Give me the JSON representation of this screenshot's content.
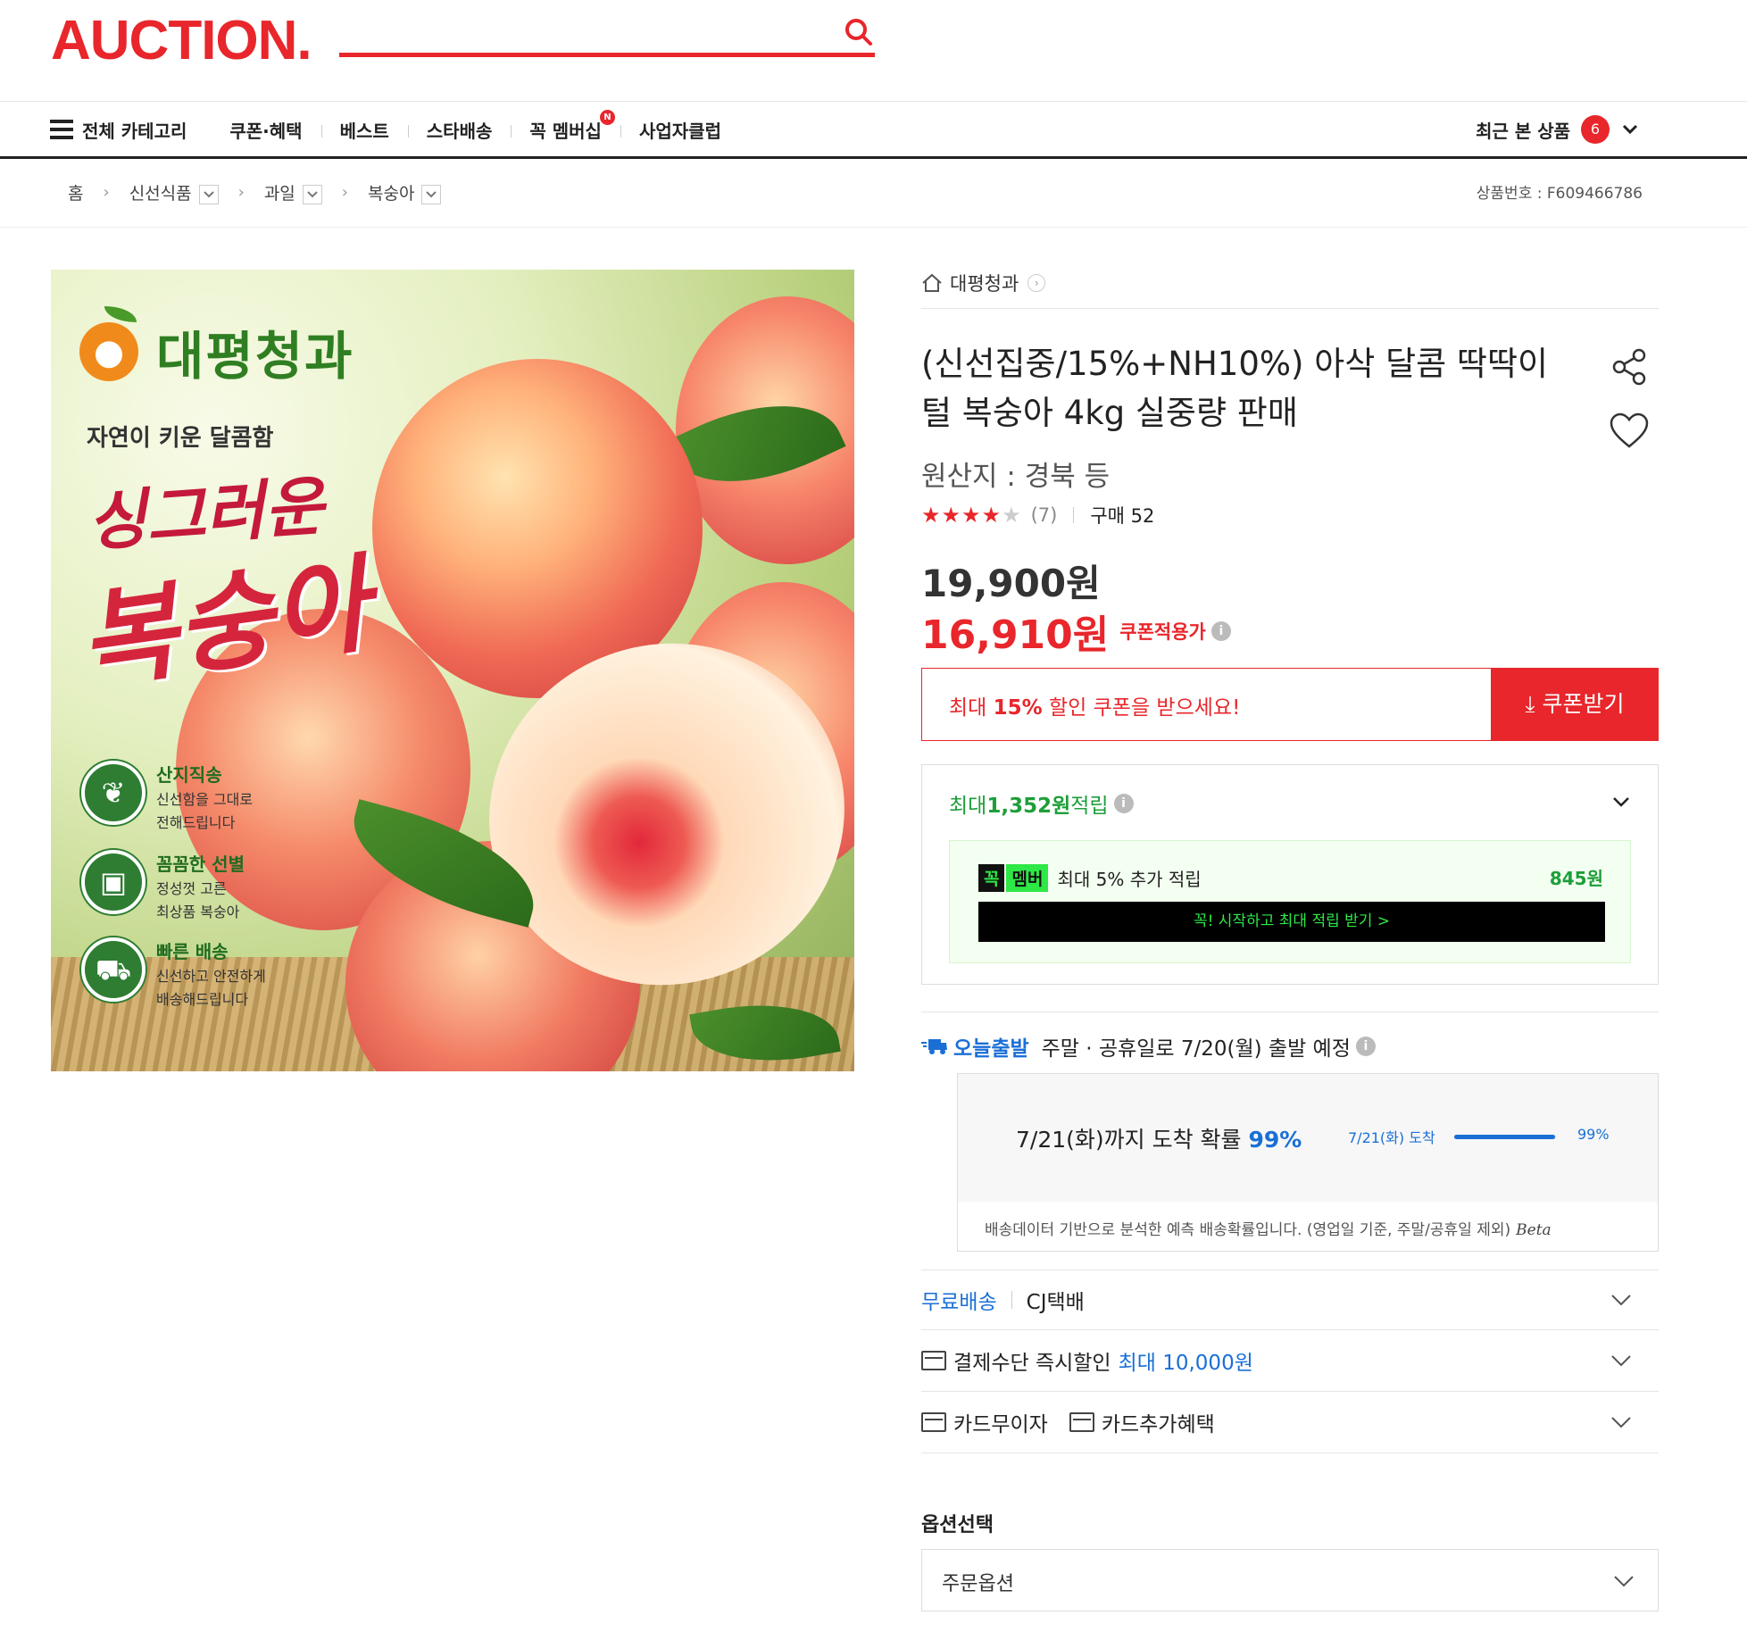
{
  "header": {
    "logo": "AUCTION.",
    "search_placeholder": ""
  },
  "gnb": {
    "all_categories": "전체 카테고리",
    "items": [
      "쿠폰·혜택",
      "베스트",
      "스타배송",
      "꼭 멤버십",
      "사업자클럽"
    ],
    "membership_badge": "N",
    "recent_label": "최근 본 상품",
    "recent_count": "6"
  },
  "breadcrumb": {
    "home": "홈",
    "levels": [
      "신선식품",
      "과일",
      "복숭아"
    ],
    "product_no": "상품번호 : F609466786"
  },
  "image": {
    "brand": "대평청과",
    "subtitle": "자연이 키운 달콤함",
    "title_line1": "싱그러운",
    "title_line2": "복숭아",
    "features": [
      {
        "title": "산지직송",
        "desc1": "신선함을 그대로",
        "desc2": "전해드립니다"
      },
      {
        "title": "꼼꼼한 선별",
        "desc1": "정성껏 고른",
        "desc2": "최상품 복숭아"
      },
      {
        "title": "빠른 배송",
        "desc1": "신선하고 안전하게",
        "desc2": "배송해드립니다"
      }
    ]
  },
  "product": {
    "store": "대평청과",
    "title": "(신선집중/15%+NH10%) 아삭 달콤 딱딱이 털 복숭아 4kg 실중량 판매",
    "origin": "원산지 : 경북 등",
    "rating_stars": 4.5,
    "review_count": "(7)",
    "buy_count": "구매 52",
    "price_original": "19,900원",
    "price_sale": "16,910원",
    "price_sale_label": "쿠폰적용가"
  },
  "coupon": {
    "text_prefix": "최대 ",
    "text_bold": "15%",
    "text_suffix": " 할인 쿠폰을 받으세요!",
    "button": "쿠폰받기"
  },
  "points": {
    "prefix": "최대 ",
    "amount": "1,352원",
    "suffix": " 적립",
    "member_badge1": "꼭",
    "member_badge2": "멤버",
    "member_text": "최대 5% 추가 적립",
    "member_amount": "845원",
    "member_cta": "꼭! 시작하고 최대 적립 받기 >"
  },
  "shipping": {
    "today_tag": "오늘출발",
    "today_text": "주말 · 공휴일로 7/20(월) 출발 예정",
    "arrive_prefix": "7/21(화)까지 도착 확률 ",
    "arrive_pct": "99%",
    "arrive_label": "7/21(화) 도착",
    "arrive_value": 0.99,
    "arrive_bar_pct": "99%",
    "arrive_note": "배송데이터 기반으로 분석한 예측 배송확률입니다. (영업일 기준, 주말/공휴일 제외)",
    "beta": "Beta"
  },
  "rows": {
    "free_ship": "무료배송",
    "courier": "CJ택배",
    "pay_discount": "결제수단 즉시할인",
    "pay_discount_amt": "최대 10,000원",
    "card_interest": "카드무이자",
    "card_benefit": "카드추가혜택"
  },
  "options": {
    "title": "옵션선택",
    "select": "주문옵션"
  },
  "colors": {
    "brand_red": "#e8262b",
    "blue": "#1a6fd6",
    "green": "#1e9e3a"
  }
}
